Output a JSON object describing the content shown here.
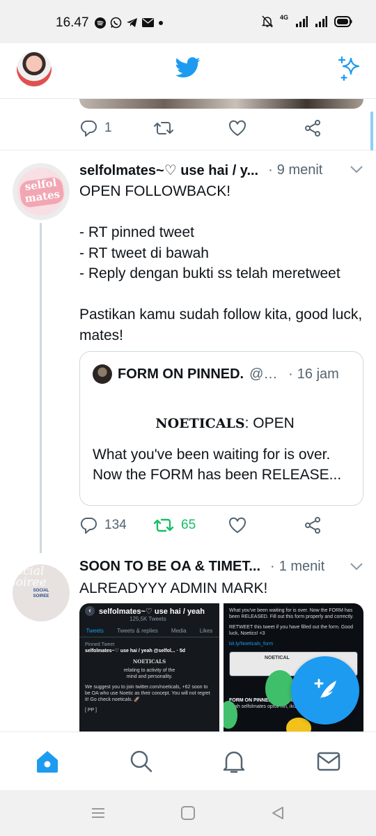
{
  "status_bar": {
    "time": "16.47",
    "network": "4G",
    "left_icons": [
      "spotify-icon",
      "whatsapp-icon",
      "telegram-icon",
      "gmail-icon",
      "dot-icon"
    ],
    "right_icons": [
      "bell-off-icon",
      "signal-icon",
      "signal-icon",
      "battery-icon"
    ]
  },
  "header": {
    "logo": "twitter-bird-icon",
    "right_action": "sparkle-icon",
    "accent": "#1d9bf0"
  },
  "previous_tweet": {
    "reply_count": "1",
    "retweet_count": "",
    "like_count": ""
  },
  "tweet1": {
    "name": "selfolmates~♡ use hai / y...",
    "separator": "·",
    "time": "9 menit",
    "avatar_text": "selfol mates",
    "text": "OPEN FOLLOWBACK!\n\n- RT pinned tweet\n- RT tweet di bawah\n- Reply dengan bukti ss telah meretweet\n\nPastikan kamu sudah follow kita, good luck, mates!",
    "quote": {
      "name": "FORM ON PINNED.",
      "handle": "@n...",
      "separator": "·",
      "time": "16 jam",
      "title_serif": "NOETICALS",
      "title_rest": ": OPEN",
      "line1": "What you've been waiting for is over.",
      "line2": "Now the FORM has been RELEASE..."
    },
    "reply_count": "134",
    "retweet_count": "65",
    "retweet_color": "#17bf63"
  },
  "tweet2": {
    "name": "SOON TO BE OA & TIMET...",
    "separator": "·",
    "time": "1 menit",
    "avatar_text": "social soiree",
    "avatar_label": "SOCIAL SOIREE",
    "text": "ALREADYYY ADMIN MARK!",
    "media_left": {
      "profile_name": "selfolmates~♡ use hai / yeah",
      "tweet_count": "125,5K Tweets",
      "tabs": [
        "Tweets",
        "Tweets & replies",
        "Media",
        "Likes"
      ],
      "pinned_label": "Pinned Tweet",
      "pinned_author": "selfolmates~♡ use hai / yeah @selfol... · 5d",
      "title": "NOETICALS",
      "desc1": "relating to activity of the",
      "desc2": "mind and personality.",
      "note": "We suggest you to join twitter.com/noeticals, +62 soon to be OA who use Noetic as their concept. You will not regret it! Go check noeticals. 🚀",
      "footer": "[ PP ]"
    },
    "media_right": {
      "line1": "What you've been waiting for is over. Now the FORM has been RELEASED. Fill out this form properly and correctly.",
      "line2": "RETWEET this tweet if you have filled out the form. Good luck, Noetics! <3",
      "link": "bit.ly/Noeticals_form",
      "card_label": "NOETICAL",
      "reply_author": "FORM ON PINNED. @noetical...",
      "reply_text": "Yeah selfolmates opfoll nih, ikutan gak?"
    }
  },
  "fab": {
    "icon": "compose-tweet-icon"
  },
  "bottom_nav": [
    "home-icon",
    "search-icon",
    "notifications-icon",
    "messages-icon"
  ],
  "system_nav": [
    "recents-icon",
    "home-button-icon",
    "back-icon"
  ]
}
